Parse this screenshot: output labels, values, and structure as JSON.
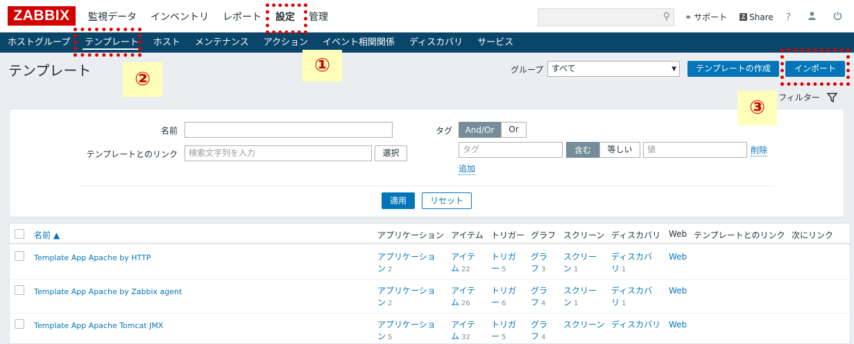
{
  "app": {
    "logo": "ZABBIX"
  },
  "main_menu": [
    "監視データ",
    "インベントリ",
    "レポート",
    "設定",
    "管理"
  ],
  "top_links": {
    "support": "サポート",
    "share": "Share",
    "help": "?"
  },
  "sub_menu": [
    "ホストグループ",
    "テンプレート",
    "ホスト",
    "メンテナンス",
    "アクション",
    "イベント相関関係",
    "ディスカバリ",
    "サービス"
  ],
  "page": {
    "title": "テンプレート",
    "group_label": "グループ",
    "group_value": "すべて",
    "create_button": "テンプレートの作成",
    "import_button": "インポート",
    "filter_tab": "フィルター"
  },
  "filter": {
    "name_label": "名前",
    "name_value": "",
    "link_label": "テンプレートとのリンク",
    "link_placeholder": "検索文字列を入力",
    "select_button": "選択",
    "tag_label": "タグ",
    "andor": "And/Or",
    "or": "Or",
    "tag_placeholder": "タグ",
    "contains": "含む",
    "equals": "等しい",
    "value_placeholder": "値",
    "remove": "削除",
    "add": "追加",
    "apply": "適用",
    "reset": "リセット"
  },
  "table": {
    "headers": [
      "名前 ▲",
      "アプリケーション",
      "アイテム",
      "トリガー",
      "グラフ",
      "スクリーン",
      "ディスカバリ",
      "Web",
      "テンプレートとのリンク",
      "次にリンク"
    ],
    "rows": [
      {
        "name": "Template App Apache by HTTP",
        "app": [
          "アプリケーショ",
          "ン",
          "2"
        ],
        "item": [
          "アイテ",
          "ム",
          "22"
        ],
        "trigger": [
          "トリガ",
          "ー",
          "5"
        ],
        "graph": [
          "グラ",
          "フ",
          "3"
        ],
        "screen": [
          "スクリー",
          "ン",
          "1"
        ],
        "discovery": [
          "ディスカバ",
          "リ",
          "1"
        ],
        "web": "Web"
      },
      {
        "name": "Template App Apache by Zabbix agent",
        "app": [
          "アプリケーショ",
          "ン",
          "2"
        ],
        "item": [
          "アイテ",
          "ム",
          "26"
        ],
        "trigger": [
          "トリガ",
          "ー",
          "6"
        ],
        "graph": [
          "グラ",
          "フ",
          "4"
        ],
        "screen": [
          "スクリー",
          "ン",
          "1"
        ],
        "discovery": [
          "ディスカバ",
          "リ",
          "1"
        ],
        "web": "Web"
      },
      {
        "name": "Template App Apache Tomcat JMX",
        "app": [
          "アプリケーショ",
          "ン",
          "5"
        ],
        "item": [
          "アイテ",
          "ム",
          "32"
        ],
        "trigger": [
          "トリガ",
          "ー",
          "5"
        ],
        "graph": [
          "グラ",
          "フ",
          "4"
        ],
        "screen": [
          "スクリーン",
          "",
          ""
        ],
        "discovery": [
          "ディスカバリ",
          "",
          ""
        ],
        "web": "Web"
      }
    ]
  },
  "annotations": [
    "①",
    "②",
    "③"
  ],
  "colors": {
    "highlight": "#e00000",
    "note_bg": "#ffffb9",
    "primary": "#0275b8",
    "nav": "#0a466a"
  }
}
